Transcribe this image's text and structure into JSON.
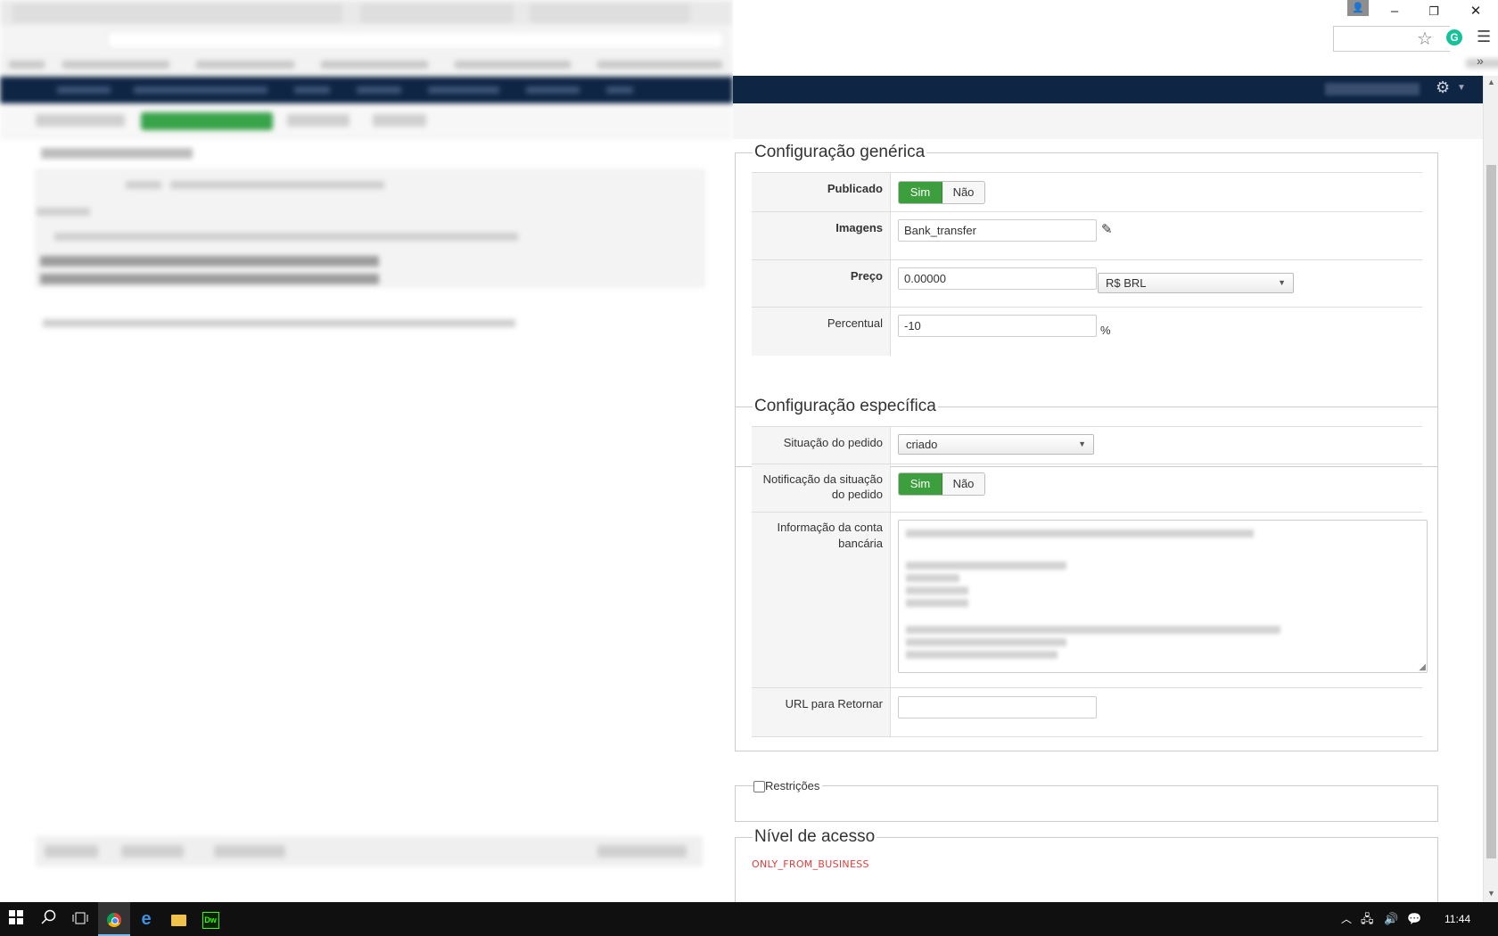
{
  "window": {
    "minimize_glyph": "–",
    "restore_glyph": "❐",
    "close_glyph": "✕"
  },
  "browser": {
    "star_icon": "star-icon",
    "menu_glyph": "☰",
    "more_bookmarks": "»",
    "grammarly_letter": "G"
  },
  "modal": {
    "generic": {
      "legend": "Configuração genérica",
      "published": {
        "label": "Publicado",
        "on": "Sim",
        "off": "Não",
        "selected": "Sim"
      },
      "images": {
        "label": "Imagens",
        "value": "Bank_transfer"
      },
      "price": {
        "label": "Preço",
        "value": "0.00000",
        "currency": "R$ BRL"
      },
      "percent": {
        "label": "Percentual",
        "value": "-10",
        "suffix": "%"
      }
    },
    "specific": {
      "legend": "Configuração específica",
      "order_status": {
        "label": "Situação do pedido",
        "value": "criado"
      },
      "notification": {
        "label_line1": "Notificação da situação",
        "label_line2": "do pedido",
        "on": "Sim",
        "off": "Não",
        "selected": "Sim"
      },
      "bank_info": {
        "label_line1": "Informação da conta",
        "label_line2": "bancária"
      },
      "return_url": {
        "label": "URL para Retornar",
        "value": ""
      }
    },
    "restrictions": {
      "label": "Restrições",
      "checked": false
    },
    "access": {
      "legend": "Nível de acesso",
      "value": "ONLY_FROM_BUSINESS"
    }
  },
  "taskbar": {
    "clock": "11:44"
  },
  "colors": {
    "navy": "#0e2544",
    "toggle_on": "#3c9e3c",
    "access_red": "#e23b3b"
  }
}
